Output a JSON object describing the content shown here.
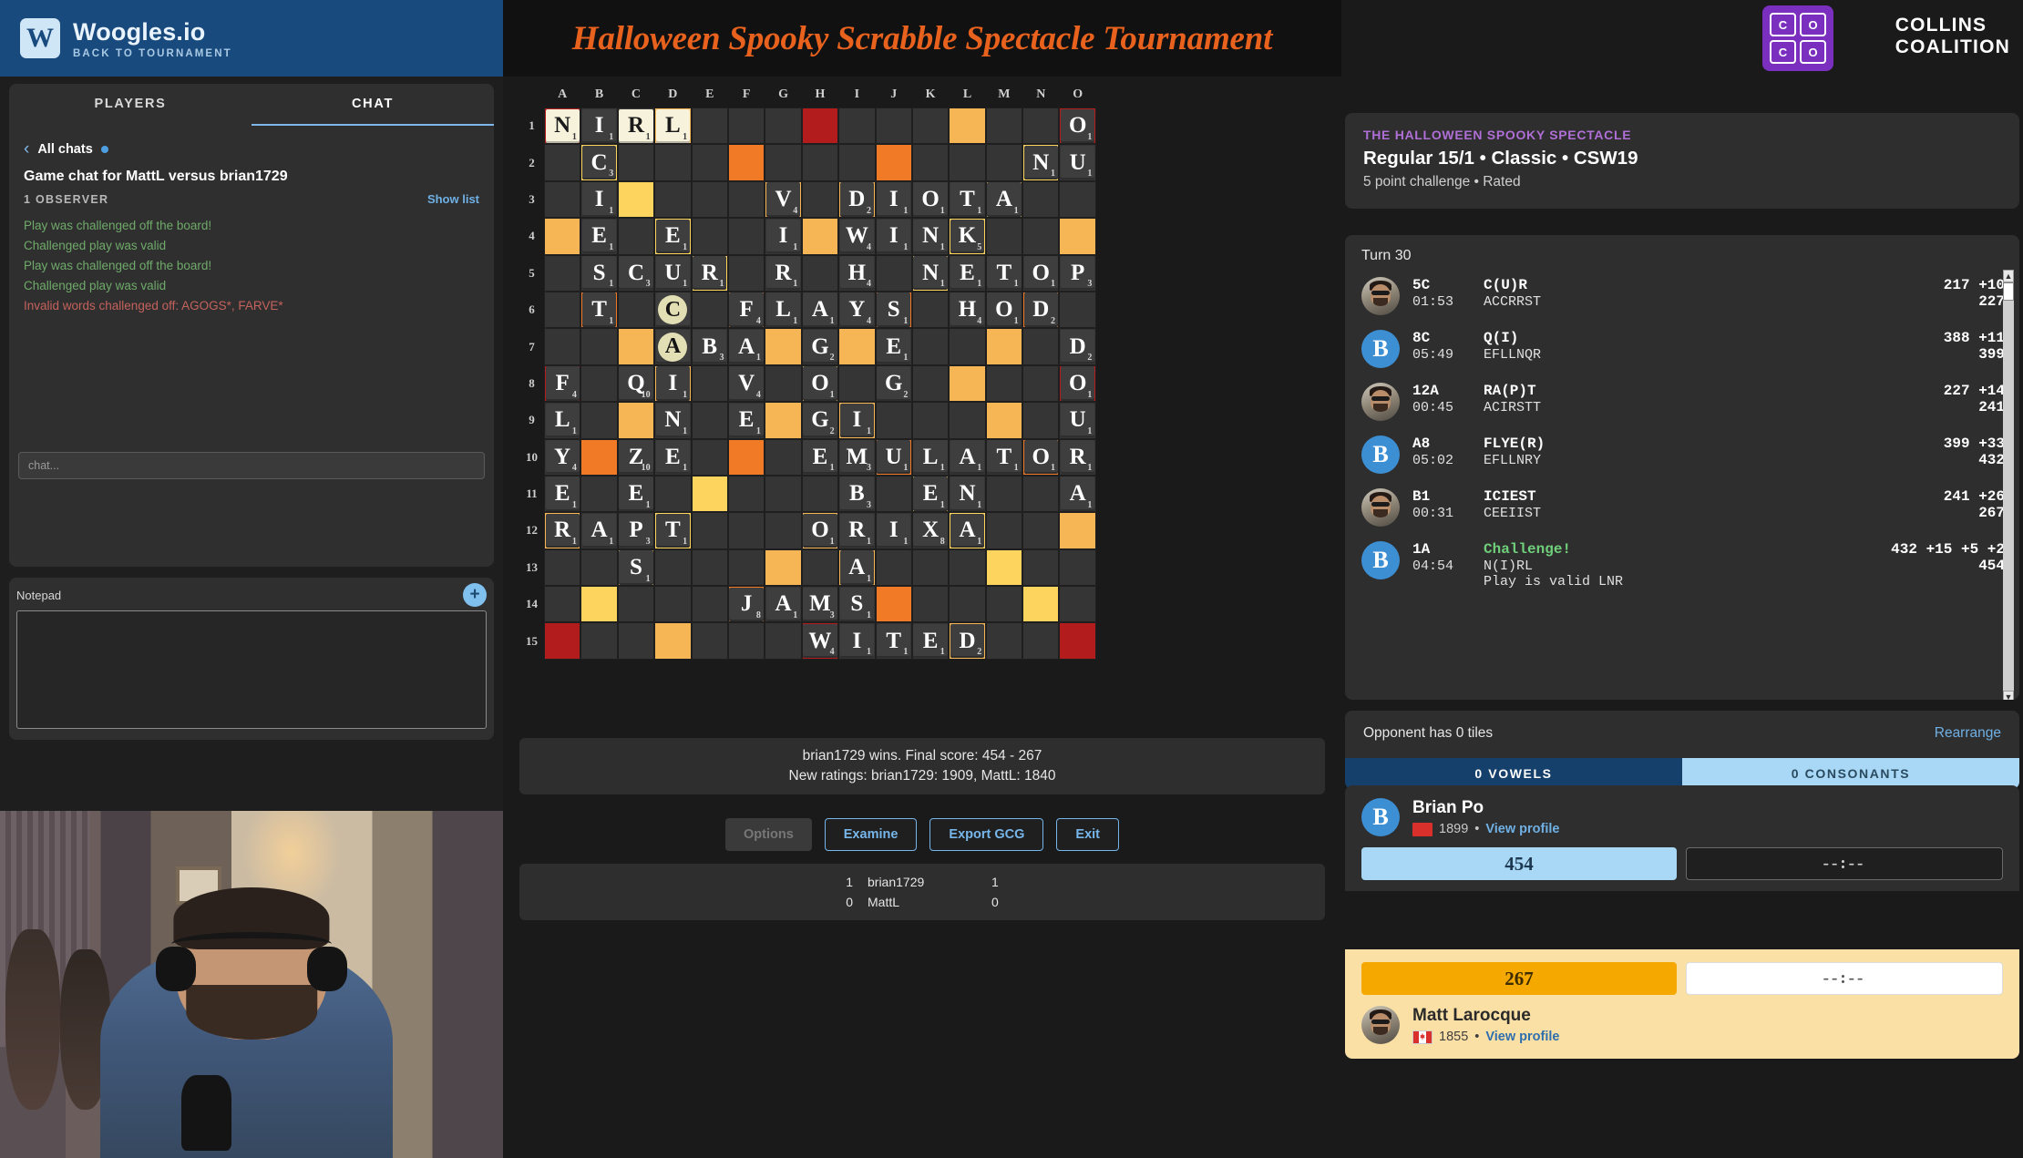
{
  "topbar": {
    "logo_letter": "W",
    "brand": "Woogles.io",
    "back_link": "BACK TO TOURNAMENT"
  },
  "chat_panel": {
    "tabs": [
      {
        "label": "PLAYERS",
        "active": false
      },
      {
        "label": "CHAT",
        "active": true
      }
    ],
    "all_chats": "All chats",
    "title": "Game chat for MattL versus brian1729",
    "observers": "1 OBSERVER",
    "show_list": "Show list",
    "messages": [
      {
        "text": "Play was challenged off the board!",
        "color": "green"
      },
      {
        "text": "Challenged play was valid",
        "color": "green"
      },
      {
        "text": "Play was challenged off the board!",
        "color": "green"
      },
      {
        "text": "Challenged play was valid",
        "color": "green"
      },
      {
        "text": "Invalid words challenged off: AGOGS*, FARVE*",
        "color": "red"
      }
    ],
    "input_placeholder": "chat..."
  },
  "notepad": {
    "label": "Notepad",
    "add_label": "+",
    "content": ""
  },
  "banner": {
    "title": "Halloween Spooky Scrabble Spectacle Tournament",
    "accent": "#e8621e"
  },
  "collins": {
    "squares": [
      "C",
      "O",
      "C",
      "O"
    ],
    "line1": "COLLINS",
    "line2": "COALITION",
    "color": "#7b2fbe"
  },
  "board": {
    "columns": [
      "A",
      "B",
      "C",
      "D",
      "E",
      "F",
      "G",
      "H",
      "I",
      "J",
      "K",
      "L",
      "M",
      "N",
      "O"
    ],
    "rows": [
      "1",
      "2",
      "3",
      "4",
      "5",
      "6",
      "7",
      "8",
      "9",
      "10",
      "11",
      "12",
      "13",
      "14",
      "15"
    ],
    "premiums": {
      "tws": [
        [
          0,
          7
        ],
        [
          14,
          0
        ],
        [
          14,
          14
        ],
        [
          0,
          14
        ]
      ],
      "dws": [
        [
          0,
          11
        ],
        [
          3,
          0
        ],
        [
          3,
          14
        ],
        [
          6,
          2
        ],
        [
          6,
          9
        ],
        [
          8,
          2
        ],
        [
          8,
          11
        ],
        [
          9,
          14
        ],
        [
          12,
          12
        ],
        [
          14,
          3
        ],
        [
          14,
          11
        ],
        [
          3,
          8
        ],
        [
          2,
          13
        ]
      ],
      "dls": [
        [
          1,
          5
        ],
        [
          1,
          9
        ],
        [
          6,
          6
        ],
        [
          9,
          1
        ],
        [
          9,
          8
        ],
        [
          12,
          12
        ],
        [
          13,
          1
        ],
        [
          13,
          11
        ],
        [
          10,
          3
        ]
      ],
      "tls": [
        [
          2,
          2
        ],
        [
          10,
          3
        ],
        [
          12,
          11
        ],
        [
          14,
          7
        ]
      ]
    },
    "tiles": [
      {
        "r": 1,
        "c": "A",
        "l": "N",
        "p": 1,
        "last": true
      },
      {
        "r": 1,
        "c": "B",
        "l": "I",
        "p": 1,
        "last": false
      },
      {
        "r": 1,
        "c": "C",
        "l": "R",
        "p": 1,
        "last": true
      },
      {
        "r": 1,
        "c": "D",
        "l": "L",
        "p": 1,
        "last": true
      },
      {
        "r": 1,
        "c": "O",
        "l": "O",
        "p": 1,
        "last": false
      },
      {
        "r": 2,
        "c": "B",
        "l": "C",
        "p": 3,
        "last": false
      },
      {
        "r": 2,
        "c": "N",
        "l": "N",
        "p": 1,
        "last": false
      },
      {
        "r": 2,
        "c": "O",
        "l": "U",
        "p": 1,
        "last": false
      },
      {
        "r": 3,
        "c": "B",
        "l": "I",
        "p": 1,
        "last": false
      },
      {
        "r": 3,
        "c": "G",
        "l": "V",
        "p": 4,
        "last": false
      },
      {
        "r": 3,
        "c": "I",
        "l": "D",
        "p": 2,
        "last": false
      },
      {
        "r": 3,
        "c": "J",
        "l": "I",
        "p": 1,
        "last": false
      },
      {
        "r": 3,
        "c": "K",
        "l": "O",
        "p": 1,
        "last": false
      },
      {
        "r": 3,
        "c": "L",
        "l": "T",
        "p": 1,
        "last": false
      },
      {
        "r": 3,
        "c": "M",
        "l": "A",
        "p": 1,
        "last": false
      },
      {
        "r": 4,
        "c": "B",
        "l": "E",
        "p": 1,
        "last": false
      },
      {
        "r": 4,
        "c": "D",
        "l": "E",
        "p": 1,
        "last": false
      },
      {
        "r": 4,
        "c": "G",
        "l": "I",
        "p": 1,
        "last": false
      },
      {
        "r": 4,
        "c": "I",
        "l": "W",
        "p": 4,
        "last": false
      },
      {
        "r": 4,
        "c": "J",
        "l": "I",
        "p": 1,
        "last": false
      },
      {
        "r": 4,
        "c": "K",
        "l": "N",
        "p": 1,
        "last": false
      },
      {
        "r": 4,
        "c": "L",
        "l": "K",
        "p": 5,
        "last": false
      },
      {
        "r": 5,
        "c": "B",
        "l": "S",
        "p": 1,
        "last": false
      },
      {
        "r": 5,
        "c": "C",
        "l": "C",
        "p": 3,
        "last": false
      },
      {
        "r": 5,
        "c": "D",
        "l": "U",
        "p": 1,
        "last": false
      },
      {
        "r": 5,
        "c": "E",
        "l": "R",
        "p": 1,
        "last": false
      },
      {
        "r": 5,
        "c": "G",
        "l": "R",
        "p": 1,
        "last": false
      },
      {
        "r": 5,
        "c": "I",
        "l": "H",
        "p": 4,
        "last": false
      },
      {
        "r": 5,
        "c": "K",
        "l": "N",
        "p": 1,
        "last": false
      },
      {
        "r": 5,
        "c": "L",
        "l": "E",
        "p": 1,
        "last": false
      },
      {
        "r": 5,
        "c": "M",
        "l": "T",
        "p": 1,
        "last": false
      },
      {
        "r": 5,
        "c": "N",
        "l": "O",
        "p": 1,
        "last": false
      },
      {
        "r": 5,
        "c": "O",
        "l": "P",
        "p": 3,
        "last": false
      },
      {
        "r": 6,
        "c": "B",
        "l": "T",
        "p": 1,
        "last": false
      },
      {
        "r": 6,
        "c": "D",
        "l": "C",
        "p": 0,
        "blank": true
      },
      {
        "r": 6,
        "c": "F",
        "l": "F",
        "p": 4,
        "last": false
      },
      {
        "r": 6,
        "c": "G",
        "l": "L",
        "p": 1,
        "last": false
      },
      {
        "r": 6,
        "c": "H",
        "l": "A",
        "p": 1,
        "last": false
      },
      {
        "r": 6,
        "c": "I",
        "l": "Y",
        "p": 4,
        "last": false
      },
      {
        "r": 6,
        "c": "J",
        "l": "S",
        "p": 1,
        "last": false
      },
      {
        "r": 6,
        "c": "L",
        "l": "H",
        "p": 4,
        "last": false
      },
      {
        "r": 6,
        "c": "M",
        "l": "O",
        "p": 1,
        "last": false
      },
      {
        "r": 6,
        "c": "N",
        "l": "D",
        "p": 2,
        "last": false
      },
      {
        "r": 7,
        "c": "D",
        "l": "A",
        "p": 0,
        "blank": true
      },
      {
        "r": 7,
        "c": "E",
        "l": "B",
        "p": 3,
        "last": false
      },
      {
        "r": 7,
        "c": "F",
        "l": "A",
        "p": 1,
        "last": false
      },
      {
        "r": 7,
        "c": "H",
        "l": "G",
        "p": 2,
        "last": false
      },
      {
        "r": 7,
        "c": "J",
        "l": "E",
        "p": 1,
        "last": false
      },
      {
        "r": 7,
        "c": "O",
        "l": "D",
        "p": 2,
        "last": false
      },
      {
        "r": 8,
        "c": "A",
        "l": "F",
        "p": 4,
        "last": false
      },
      {
        "r": 8,
        "c": "C",
        "l": "Q",
        "p": 10,
        "last": false
      },
      {
        "r": 8,
        "c": "D",
        "l": "I",
        "p": 1,
        "last": false
      },
      {
        "r": 8,
        "c": "F",
        "l": "V",
        "p": 4,
        "last": false
      },
      {
        "r": 8,
        "c": "H",
        "l": "O",
        "p": 1,
        "last": false
      },
      {
        "r": 8,
        "c": "J",
        "l": "G",
        "p": 2,
        "last": false
      },
      {
        "r": 8,
        "c": "O",
        "l": "O",
        "p": 1,
        "last": false
      },
      {
        "r": 9,
        "c": "A",
        "l": "L",
        "p": 1,
        "last": false
      },
      {
        "r": 9,
        "c": "D",
        "l": "N",
        "p": 1,
        "last": false
      },
      {
        "r": 9,
        "c": "F",
        "l": "E",
        "p": 1,
        "last": false
      },
      {
        "r": 9,
        "c": "H",
        "l": "G",
        "p": 2,
        "last": false
      },
      {
        "r": 9,
        "c": "I",
        "l": "I",
        "p": 1,
        "last": false
      },
      {
        "r": 9,
        "c": "O",
        "l": "U",
        "p": 1,
        "last": false
      },
      {
        "r": 10,
        "c": "A",
        "l": "Y",
        "p": 4,
        "last": false
      },
      {
        "r": 10,
        "c": "C",
        "l": "Z",
        "p": 10,
        "last": false
      },
      {
        "r": 10,
        "c": "D",
        "l": "E",
        "p": 1,
        "last": false
      },
      {
        "r": 10,
        "c": "H",
        "l": "E",
        "p": 1,
        "last": false
      },
      {
        "r": 10,
        "c": "I",
        "l": "M",
        "p": 3,
        "last": false
      },
      {
        "r": 10,
        "c": "J",
        "l": "U",
        "p": 1,
        "last": false
      },
      {
        "r": 10,
        "c": "K",
        "l": "L",
        "p": 1,
        "last": false
      },
      {
        "r": 10,
        "c": "L",
        "l": "A",
        "p": 1,
        "last": false
      },
      {
        "r": 10,
        "c": "M",
        "l": "T",
        "p": 1,
        "last": false
      },
      {
        "r": 10,
        "c": "N",
        "l": "O",
        "p": 1,
        "last": false
      },
      {
        "r": 10,
        "c": "O",
        "l": "R",
        "p": 1,
        "last": false
      },
      {
        "r": 11,
        "c": "A",
        "l": "E",
        "p": 1,
        "last": false
      },
      {
        "r": 11,
        "c": "C",
        "l": "E",
        "p": 1,
        "last": false
      },
      {
        "r": 11,
        "c": "I",
        "l": "B",
        "p": 3,
        "last": false
      },
      {
        "r": 11,
        "c": "K",
        "l": "E",
        "p": 1,
        "last": false
      },
      {
        "r": 11,
        "c": "L",
        "l": "N",
        "p": 1,
        "last": false
      },
      {
        "r": 11,
        "c": "O",
        "l": "A",
        "p": 1,
        "last": false
      },
      {
        "r": 12,
        "c": "A",
        "l": "R",
        "p": 1,
        "last": false
      },
      {
        "r": 12,
        "c": "B",
        "l": "A",
        "p": 1,
        "last": false
      },
      {
        "r": 12,
        "c": "C",
        "l": "P",
        "p": 3,
        "last": false
      },
      {
        "r": 12,
        "c": "D",
        "l": "T",
        "p": 1,
        "last": false
      },
      {
        "r": 12,
        "c": "H",
        "l": "O",
        "p": 1,
        "last": false
      },
      {
        "r": 12,
        "c": "I",
        "l": "R",
        "p": 1,
        "last": false
      },
      {
        "r": 12,
        "c": "J",
        "l": "I",
        "p": 1,
        "last": false
      },
      {
        "r": 12,
        "c": "K",
        "l": "X",
        "p": 8,
        "last": false
      },
      {
        "r": 12,
        "c": "L",
        "l": "A",
        "p": 1,
        "last": false
      },
      {
        "r": 13,
        "c": "C",
        "l": "S",
        "p": 1,
        "last": false
      },
      {
        "r": 13,
        "c": "I",
        "l": "A",
        "p": 1,
        "last": false
      },
      {
        "r": 14,
        "c": "F",
        "l": "J",
        "p": 8,
        "last": false
      },
      {
        "r": 14,
        "c": "G",
        "l": "A",
        "p": 1,
        "last": false
      },
      {
        "r": 14,
        "c": "H",
        "l": "M",
        "p": 3,
        "last": false
      },
      {
        "r": 14,
        "c": "I",
        "l": "S",
        "p": 1,
        "last": false
      },
      {
        "r": 15,
        "c": "H",
        "l": "W",
        "p": 4,
        "last": false
      },
      {
        "r": 15,
        "c": "I",
        "l": "I",
        "p": 1,
        "last": false
      },
      {
        "r": 15,
        "c": "J",
        "l": "T",
        "p": 1,
        "last": false
      },
      {
        "r": 15,
        "c": "K",
        "l": "E",
        "p": 1,
        "last": false
      },
      {
        "r": 15,
        "c": "L",
        "l": "D",
        "p": 2,
        "last": false
      }
    ]
  },
  "result": {
    "line1": "brian1729 wins. Final score: 454 - 267",
    "line2": "New ratings: brian1729: 1909, MattL: 1840"
  },
  "buttons": {
    "options": "Options",
    "examine": "Examine",
    "export": "Export GCG",
    "exit": "Exit"
  },
  "match_score": {
    "rows": [
      {
        "left": "1",
        "center": "brian1729",
        "right": "1"
      },
      {
        "left": "0",
        "center": "MattL",
        "right": "0"
      }
    ]
  },
  "meta": {
    "event": "THE HALLOWEEN SPOOKY SPECTACLE",
    "line1": "Regular 15/1 • Classic • CSW19",
    "line2": "5 point challenge • Rated"
  },
  "turns": {
    "label": "Turn 30",
    "entries": [
      {
        "avatar": "photo",
        "pos": "5C",
        "word": "C(U)R",
        "time": "01:53",
        "rack": "ACCRRST",
        "score": "217 +10",
        "total": "227",
        "note": "",
        "challenge": false
      },
      {
        "avatar": "B",
        "pos": "8C",
        "word": "Q(I)",
        "time": "05:49",
        "rack": "EFLLNQR",
        "score": "388 +11",
        "total": "399",
        "note": "",
        "challenge": false
      },
      {
        "avatar": "photo",
        "pos": "12A",
        "word": "RA(P)T",
        "time": "00:45",
        "rack": "ACIRSTT",
        "score": "227 +14",
        "total": "241",
        "note": "",
        "challenge": false
      },
      {
        "avatar": "B",
        "pos": "A8",
        "word": "FLYE(R)",
        "time": "05:02",
        "rack": "EFLLNRY",
        "score": "399 +33",
        "total": "432",
        "note": "",
        "challenge": false
      },
      {
        "avatar": "photo",
        "pos": "B1",
        "word": "ICIEST",
        "time": "00:31",
        "rack": "CEEIIST",
        "score": "241 +26",
        "total": "267",
        "note": "",
        "challenge": false
      },
      {
        "avatar": "B",
        "pos": "1A",
        "word": "Challenge!",
        "time": "04:54",
        "rack": "N(I)RL",
        "score": "432 +15 +5 +2",
        "total": "454",
        "note": "Play is valid LNR",
        "challenge": true
      }
    ]
  },
  "rack": {
    "opponent_tiles": "Opponent has 0 tiles",
    "rearrange": "Rearrange",
    "vowels": "0 VOWELS",
    "consonants": "0 CONSONANTS"
  },
  "players": {
    "top": {
      "name": "Brian Po",
      "avatar_letter": "B",
      "flag": "us",
      "rating": "1899",
      "view_profile": "View profile",
      "score": "454",
      "clock": "--:--"
    },
    "bottom": {
      "name": "Matt Larocque",
      "avatar_letter": "",
      "flag": "ca",
      "rating": "1855",
      "view_profile": "View profile",
      "score": "267",
      "clock": "--:--"
    }
  }
}
